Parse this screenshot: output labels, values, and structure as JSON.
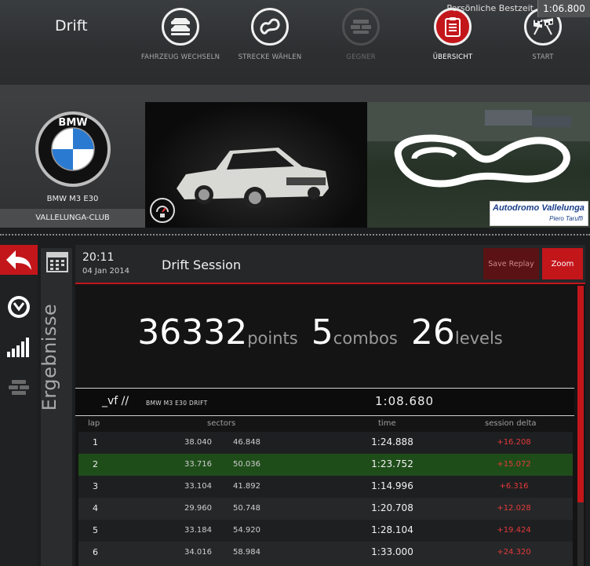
{
  "app": {
    "title": "Drift"
  },
  "nav": [
    {
      "label": "FAHRZEUG WECHSELN",
      "icon": "cars-icon",
      "state": "normal"
    },
    {
      "label": "STRECKE WÄHLEN",
      "icon": "track-icon",
      "state": "normal"
    },
    {
      "label": "GEGNER",
      "icon": "opponents-icon",
      "state": "disabled"
    },
    {
      "label": "ÜBERSICHT",
      "icon": "clipboard-icon",
      "state": "active"
    },
    {
      "label": "START",
      "icon": "checkered-flags-icon",
      "state": "normal"
    }
  ],
  "best": {
    "label": "Persönliche Bestzeit",
    "value": "1:06.800"
  },
  "car": {
    "brand_logo_text": "BMW",
    "name": "BMW M3 E30",
    "track_short": "VALLELUNGA-CLUB"
  },
  "track_logo": {
    "main": "Autodromo Vallelunga",
    "sub": "Piero Taruffi"
  },
  "sidebar": {
    "icons": [
      "back-arrow-icon",
      "clock-icon",
      "signal-bars-icon",
      "opponents-icon"
    ]
  },
  "tab": {
    "label": "Ergebnisse"
  },
  "session": {
    "time": "20:11",
    "date": "04 Jan 2014",
    "title": "Drift Session",
    "save_replay": "Save Replay",
    "zoom": "Zoom"
  },
  "score": {
    "points": "36332",
    "points_label": "points",
    "combos": "5",
    "combos_label": "combos",
    "levels": "26",
    "levels_label": "levels"
  },
  "driver": {
    "name": "_vf //",
    "car": "BMW M3 E30 DRIFT",
    "best": "1:08.680"
  },
  "table": {
    "headers": {
      "lap": "lap",
      "sectors": "sectors",
      "time": "time",
      "delta": "session delta"
    },
    "rows": [
      {
        "lap": "1",
        "s1": "38.040",
        "s2": "46.848",
        "time": "1:24.888",
        "delta": "+16.208"
      },
      {
        "lap": "2",
        "s1": "33.716",
        "s2": "50.036",
        "time": "1:23.752",
        "delta": "+15.072"
      },
      {
        "lap": "3",
        "s1": "33.104",
        "s2": "41.892",
        "time": "1:14.996",
        "delta": "+6.316"
      },
      {
        "lap": "4",
        "s1": "29.960",
        "s2": "50.748",
        "time": "1:20.708",
        "delta": "+12.028"
      },
      {
        "lap": "5",
        "s1": "33.184",
        "s2": "54.920",
        "time": "1:28.104",
        "delta": "+19.424"
      },
      {
        "lap": "6",
        "s1": "34.016",
        "s2": "58.984",
        "time": "1:33.000",
        "delta": "+24.320"
      }
    ]
  },
  "colors": {
    "accent": "#c3161b",
    "highlight_row": "#1f4d1a",
    "delta": "#e53a3a"
  }
}
